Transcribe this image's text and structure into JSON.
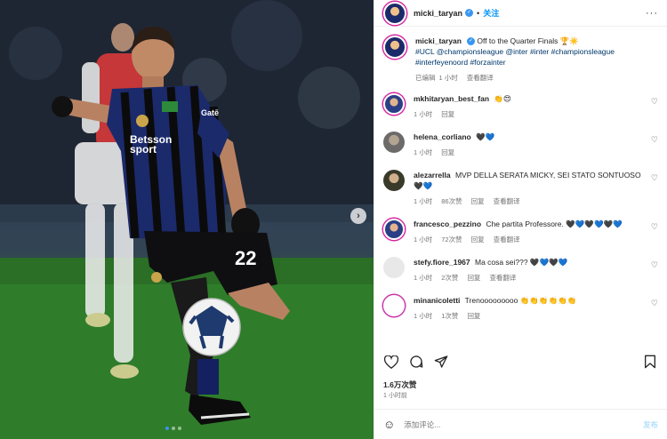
{
  "post": {
    "author": "micki_taryan",
    "follow_label": "关注",
    "caption_text": "Off to the Quarter Finals 🏆☀️",
    "hashtags": [
      "#UCL",
      "@championsleague",
      "@inter",
      "#inter",
      "#championsleague",
      "#interfeyenoord",
      "#forzainter"
    ],
    "edited_label": "已编辑",
    "caption_time": "1 小时",
    "caption_translate": "查看翻译",
    "likes": "1.6万次赞",
    "post_time": "1 小时前",
    "comment_placeholder": "添加评论...",
    "post_button": "发布"
  },
  "comments": [
    {
      "user": "mkhitaryan_best_fan",
      "text": "👏😍",
      "time": "1 小时",
      "likes": "",
      "reply": "回复",
      "translate": ""
    },
    {
      "user": "helena_corliano",
      "text": "🖤💙",
      "time": "1 小时",
      "likes": "",
      "reply": "回复",
      "translate": ""
    },
    {
      "user": "alezarrella",
      "text": "MVP DELLA SERATA MICKY, SEI STATO SONTUOSO 🖤💙",
      "time": "1 小时",
      "likes": "86次赞",
      "reply": "回复",
      "translate": "查看翻译"
    },
    {
      "user": "francesco_pezzino",
      "text": "Che partita Professore. 🖤💙🖤💙🖤💙",
      "time": "1 小时",
      "likes": "72次赞",
      "reply": "回复",
      "translate": "查看翻译"
    },
    {
      "user": "stefy.fiore_1967",
      "text": "Ma cosa sei??? 🖤💙🖤💙",
      "time": "1 小时",
      "likes": "2次赞",
      "reply": "回复",
      "translate": "查看翻译"
    },
    {
      "user": "minanicoletti",
      "text": "Trenooooooooo 👏👏👏👏👏👏",
      "time": "1 小时",
      "likes": "1次赞",
      "reply": "回复",
      "translate": ""
    }
  ],
  "photo": {
    "shirt_sponsor": "Betsson sport",
    "sleeve_sponsor": "Gatē",
    "shirt_number": "22"
  },
  "colors": {
    "accent": "#0095f6",
    "inter_blue": "#1b2a6b",
    "pitch": "#2c7a27"
  }
}
